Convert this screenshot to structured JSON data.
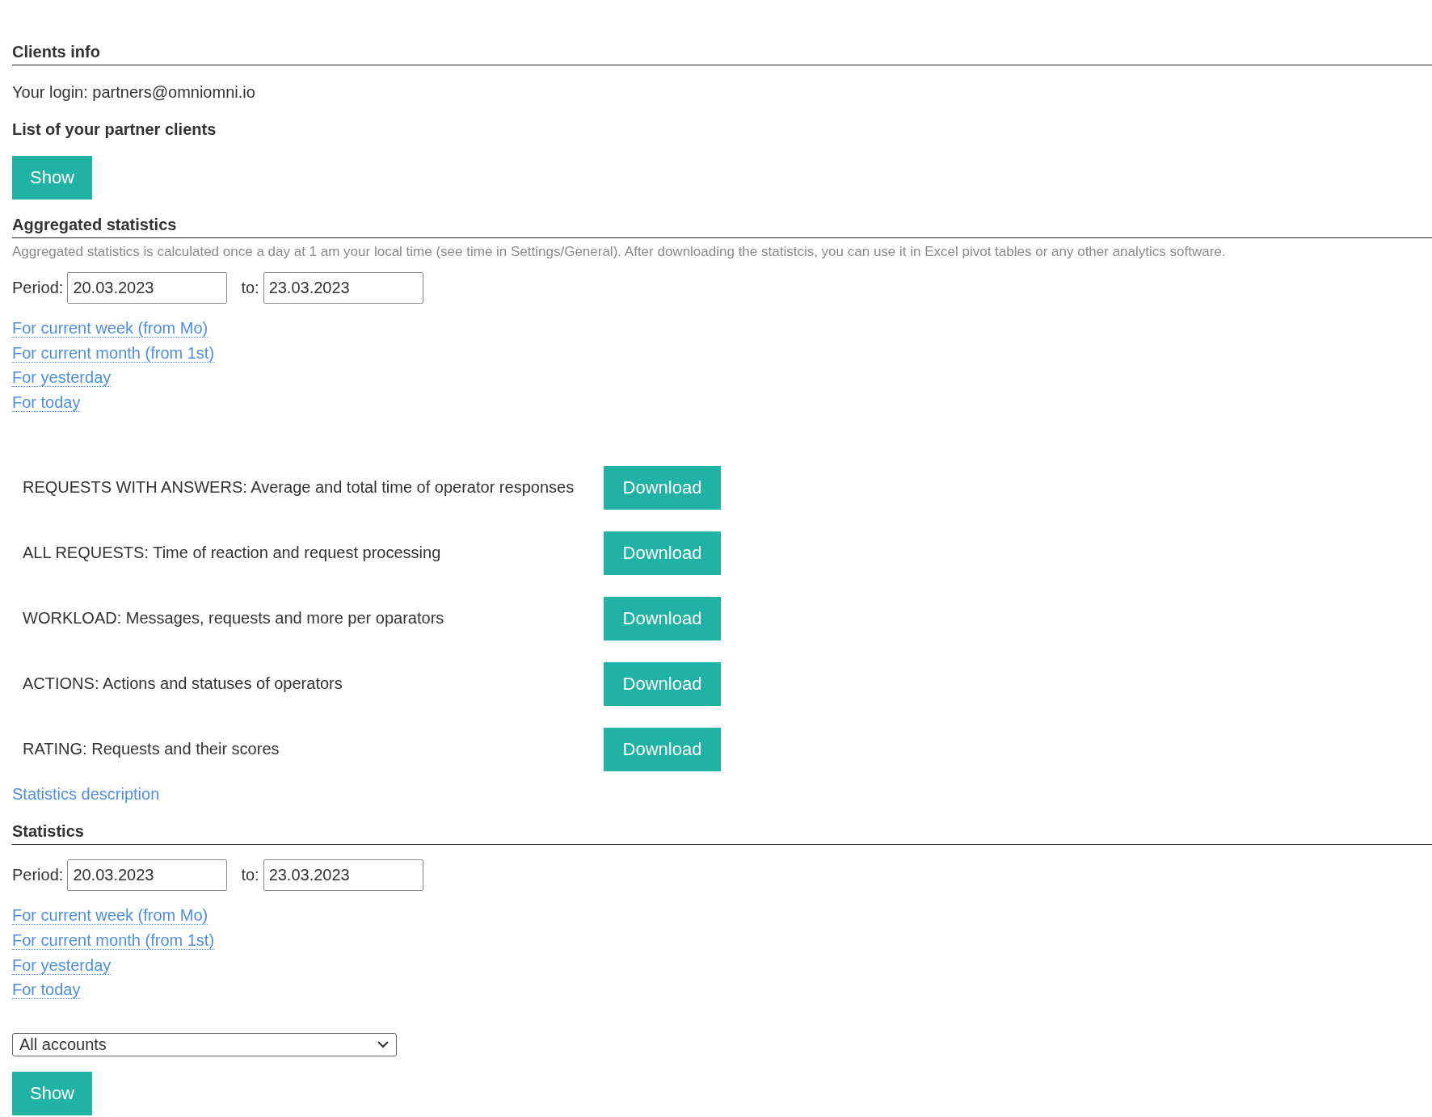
{
  "clients_info": {
    "title": "Clients info",
    "login": "Your login: partners@omniomni.io",
    "subtitle": "List of your partner clients",
    "button": "Show"
  },
  "aggregated_statistics": {
    "title": "Aggregated statistics",
    "description": "Aggregated statistics is calculated once a day at 1 am your local time (see time in Settings/General). After downloading the statistcis, you can use it in Excel pivot tables or any other analytics software.",
    "period": {
      "label": "Period:",
      "from": "20.03.2023",
      "to_label": "to:",
      "to": "23.03.2023"
    },
    "quick_links": [
      "For current week (from Mo)",
      "For current month (from 1st)",
      "For yesterday",
      "For today"
    ],
    "reports": [
      {
        "label": "REQUESTS WITH ANSWERS: Average and total time of operator responses",
        "button": "Download"
      },
      {
        "label": "ALL REQUESTS: Time of reaction and request processing",
        "button": "Download"
      },
      {
        "label": "WORKLOAD: Messages, requests and more per oparators",
        "button": "Download"
      },
      {
        "label": "ACTIONS: Actions and statuses of operators",
        "button": "Download"
      },
      {
        "label": "RATING: Requests and their scores",
        "button": "Download"
      }
    ],
    "description_link": "Statistics description"
  },
  "statistics": {
    "title": "Statistics",
    "period": {
      "label": "Period:",
      "from": "20.03.2023",
      "to_label": "to:",
      "to": "23.03.2023"
    },
    "quick_links": [
      "For current week (from Mo)",
      "For current month (from 1st)",
      "For yesterday",
      "For today"
    ],
    "account_select": "All accounts",
    "button": "Show"
  }
}
